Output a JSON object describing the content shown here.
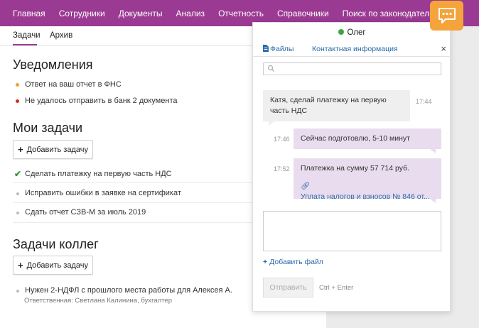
{
  "nav": {
    "items": [
      "Главная",
      "Сотрудники",
      "Документы",
      "Анализ",
      "Отчетность",
      "Справочники",
      "Поиск по законодательству"
    ]
  },
  "subtabs": {
    "tasks": "Задачи",
    "archive": "Архив"
  },
  "notifications": {
    "title": "Уведомления",
    "items": [
      {
        "text": "Ответ на ваш отчет в ФНС",
        "color": "#f0a030"
      },
      {
        "text": "Не удалось отправить в банк 2 документа",
        "color": "#d22a1e"
      }
    ]
  },
  "my_tasks": {
    "title": "Мои задачи",
    "add_label": "Добавить задачу",
    "items": [
      {
        "text": "Сделать платежку на первую часть НДС",
        "done": true
      },
      {
        "text": "Исправить ошибки в заявке на сертификат",
        "done": false
      },
      {
        "text": "Сдать отчет СЗВ-М за июль 2019",
        "done": false
      }
    ]
  },
  "colleague_tasks": {
    "title": "Задачи коллег",
    "add_label": "Добавить задачу",
    "items": [
      {
        "text": "Нужен 2-НДФЛ с прошлого места работы для Алексея А.",
        "sub": "Ответственная: Светлана Калинина, бухгалтер"
      }
    ]
  },
  "chat": {
    "user": "Олег",
    "tabs": {
      "files": "Файлы",
      "contacts": "Контактная информация"
    },
    "close": "×",
    "search_placeholder": "",
    "messages": [
      {
        "text": "Катя, сделай платежку на первую часть НДС",
        "time": "17:44",
        "side": "left"
      },
      {
        "text": "Сейчас подготовлю, 5-10 минут",
        "time": "17:46",
        "side": "right"
      },
      {
        "text": "Платежка на сумму 57 714 руб.",
        "attachment": "Уплата налогов и взносов № 846 от...",
        "time": "17:52",
        "side": "right"
      }
    ],
    "add_file": "Добавить файл",
    "send": "Отправить",
    "send_hint": "Ctrl + Enter"
  },
  "colors": {
    "brand": "#9b3a93",
    "accent": "#f4a43a",
    "online": "#3ba640",
    "link": "#2a6aa8"
  }
}
